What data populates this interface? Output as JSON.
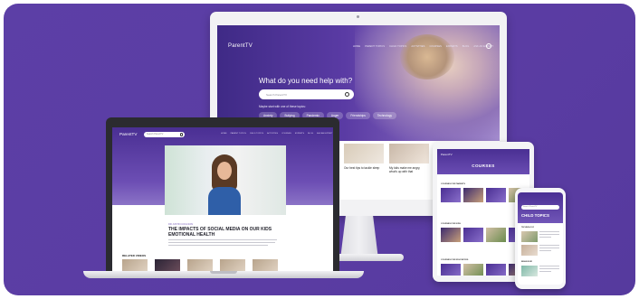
{
  "desktop": {
    "logo": "ParentTV",
    "nav": [
      "HOME",
      "PARENT TOPICS",
      "CHILD TOPICS",
      "ACTIVITIES",
      "COURSES",
      "EXPERTS",
      "BLOG",
      "ASK AN EXPERT"
    ],
    "headline": "What do you need help with?",
    "search_placeholder": "Search ParentTV",
    "maybe_text": "Maybe start with one of these topics:",
    "chips": [
      "Anxiety",
      "Bullying",
      "Pandemic",
      "Anger",
      "Friendships",
      "Technology"
    ],
    "cards": [
      {
        "title": "Our best tips to tackle sleep"
      },
      {
        "title": "My kids make me angry, what's up with that"
      },
      {
        "title": "What's ok and what's not..."
      }
    ]
  },
  "laptop": {
    "logo": "ParentTV",
    "search_placeholder": "Search ParentTV",
    "nav": [
      "HOME",
      "PARENT TOPICS",
      "CHILD TOPICS",
      "ACTIVITIES",
      "COURSES",
      "EXPERTS",
      "BLOG",
      "ASK AN EXPERT"
    ],
    "kicker": "DR JUSTIN COULSON",
    "title": "THE IMPACTS OF SOCIAL MEDIA ON OUR KIDS EMOTIONAL HEALTH",
    "related": "RELATED VIDEOS"
  },
  "tablet": {
    "logo": "ParentTV",
    "title": "COURSES",
    "sections": [
      "COURSES FOR PARENTS",
      "COURSES FOR KIDS",
      "COURSES FOR EDUCATORS"
    ]
  },
  "phone": {
    "search_placeholder": "Search ParentTV",
    "title": "CHILD TOPICS",
    "sections": [
      "TECHNOLOGY",
      "BEHAVIOUR"
    ]
  },
  "colors": {
    "background": "#5a3ca3",
    "brand_purple": "#4a2f93"
  }
}
